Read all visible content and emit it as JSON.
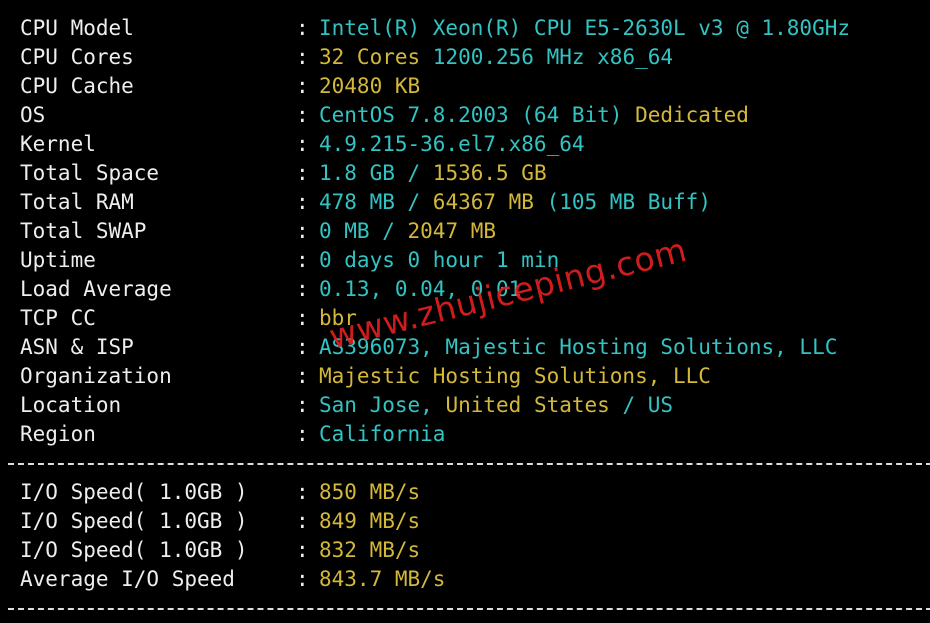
{
  "system": [
    {
      "label": "CPU Model",
      "parts": [
        {
          "text": "Intel(R) Xeon(R) CPU E5-2630L v3 @ 1.80GHz",
          "color": "cyan"
        }
      ]
    },
    {
      "label": "CPU Cores",
      "parts": [
        {
          "text": "32 Cores",
          "color": "yellow"
        },
        {
          "text": " 1200.256 MHz x86_64",
          "color": "cyan"
        }
      ]
    },
    {
      "label": "CPU Cache",
      "parts": [
        {
          "text": "20480 KB",
          "color": "yellow"
        }
      ]
    },
    {
      "label": "OS",
      "parts": [
        {
          "text": "CentOS 7.8.2003 (64 Bit)",
          "color": "cyan"
        },
        {
          "text": " Dedicated",
          "color": "yellow"
        }
      ]
    },
    {
      "label": "Kernel",
      "parts": [
        {
          "text": "4.9.215-36.el7.x86_64",
          "color": "cyan"
        }
      ]
    },
    {
      "label": "Total Space",
      "parts": [
        {
          "text": "1.8 GB / ",
          "color": "cyan"
        },
        {
          "text": "1536.5 GB",
          "color": "yellow"
        }
      ]
    },
    {
      "label": "Total RAM",
      "parts": [
        {
          "text": "478 MB / ",
          "color": "cyan"
        },
        {
          "text": "64367 MB",
          "color": "yellow"
        },
        {
          "text": " (105 MB Buff)",
          "color": "cyan"
        }
      ]
    },
    {
      "label": "Total SWAP",
      "parts": [
        {
          "text": "0 MB / ",
          "color": "cyan"
        },
        {
          "text": "2047 MB",
          "color": "yellow"
        }
      ]
    },
    {
      "label": "Uptime",
      "parts": [
        {
          "text": "0 days 0 hour 1 min",
          "color": "cyan"
        }
      ]
    },
    {
      "label": "Load Average",
      "parts": [
        {
          "text": "0.13, 0.04, 0.01",
          "color": "cyan"
        }
      ]
    },
    {
      "label": "TCP CC",
      "parts": [
        {
          "text": "bbr",
          "color": "yellow"
        }
      ]
    },
    {
      "label": "ASN & ISP",
      "parts": [
        {
          "text": "AS396073, Majestic Hosting Solutions, LLC",
          "color": "cyan"
        }
      ]
    },
    {
      "label": "Organization",
      "parts": [
        {
          "text": "Majestic Hosting Solutions, LLC",
          "color": "yellow"
        }
      ]
    },
    {
      "label": "Location",
      "parts": [
        {
          "text": "San Jose, ",
          "color": "cyan"
        },
        {
          "text": "United States",
          "color": "yellow"
        },
        {
          "text": " / US",
          "color": "cyan"
        }
      ]
    },
    {
      "label": "Region",
      "parts": [
        {
          "text": "California",
          "color": "cyan"
        }
      ]
    }
  ],
  "io": [
    {
      "label": "I/O Speed( 1.0GB )",
      "parts": [
        {
          "text": "850 MB/s",
          "color": "yellow"
        }
      ]
    },
    {
      "label": "I/O Speed( 1.0GB )",
      "parts": [
        {
          "text": "849 MB/s",
          "color": "yellow"
        }
      ]
    },
    {
      "label": "I/O Speed( 1.0GB )",
      "parts": [
        {
          "text": "832 MB/s",
          "color": "yellow"
        }
      ]
    },
    {
      "label": "Average I/O Speed",
      "parts": [
        {
          "text": "843.7 MB/s",
          "color": "yellow"
        }
      ]
    }
  ],
  "separator_char": ":",
  "watermark": "www.zhujiceping.com",
  "colors": {
    "background": "#000000",
    "text": "#eeeeee",
    "cyan": "#33c3c3",
    "yellow": "#d4b83a",
    "watermark": "#e11f1f"
  }
}
